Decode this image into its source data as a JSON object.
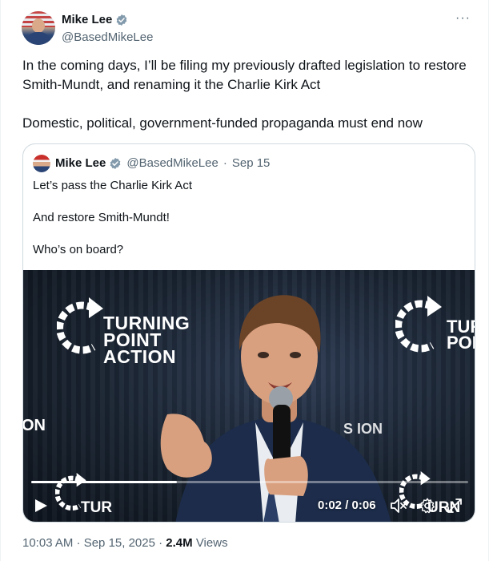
{
  "author": {
    "name": "Mike Lee",
    "handle": "@BasedMikeLee",
    "verified_badge_icon": "verified-badge-icon",
    "badge_color": "#829aab"
  },
  "menu": {
    "more_label": "···"
  },
  "tweet": {
    "paragraphs": [
      "In the coming days, I’ll be filing my previously drafted legislation to restore Smith-Mundt, and renaming it the Charlie Kirk Act",
      "Domestic, political, government-funded propaganda must end now"
    ]
  },
  "quoted": {
    "name": "Mike Lee",
    "handle": "@BasedMikeLee",
    "separator": "·",
    "date": "Sep 15",
    "lines": [
      "Let’s pass the Charlie Kirk Act",
      "And restore Smith-Mundt!",
      "Who’s on board?"
    ],
    "video": {
      "logo_line1": "TURNING",
      "logo_line2": "POINT ACTION",
      "logo_right_line1": "TURN",
      "logo_right_line2": "POIN",
      "frag_left": "ON",
      "frag_mid": "S   ION",
      "frag_bottom_left": "TUR",
      "frag_bottom_right": "URN",
      "time": "0:02 / 0:06",
      "progress_fraction": 0.333
    }
  },
  "footer": {
    "timestamp": "10:03 AM · Sep 15, 2025 ·",
    "views_count": "2.4M",
    "views_label": "Views"
  }
}
